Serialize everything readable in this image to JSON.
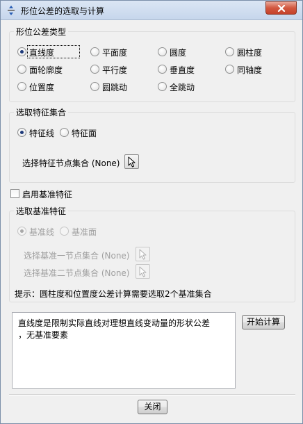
{
  "window": {
    "title": "形位公差的选取与计算"
  },
  "tolerance_type": {
    "group_label": "形位公差类型",
    "options": [
      {
        "label": "直线度",
        "checked": true
      },
      {
        "label": "平面度",
        "checked": false
      },
      {
        "label": "圆度",
        "checked": false
      },
      {
        "label": "圆柱度",
        "checked": false
      },
      {
        "label": "面轮廓度",
        "checked": false
      },
      {
        "label": "平行度",
        "checked": false
      },
      {
        "label": "垂直度",
        "checked": false
      },
      {
        "label": "同轴度",
        "checked": false
      },
      {
        "label": "位置度",
        "checked": false
      },
      {
        "label": "圆跳动",
        "checked": false
      },
      {
        "label": "全跳动",
        "checked": false
      }
    ]
  },
  "feature_set": {
    "group_label": "选取特征集合",
    "option_line": "特征线",
    "option_face": "特征面",
    "selected": "特征线",
    "node_set_label": "选择特征节点集合 (None)"
  },
  "datum_enable": {
    "label": "启用基准特征",
    "checked": false
  },
  "datum": {
    "group_label": "选取基准特征",
    "option_line": "基准线",
    "option_face": "基准面",
    "selected": "基准线",
    "node_set_1_label": "选择基准一节点集合 (None)",
    "node_set_2_label": "选择基准二节点集合 (None)"
  },
  "hint": "提示：圆柱度和位置度公差计算需要选取2个基准集合",
  "description": {
    "line1": "直线度是限制实际直线对理想直线变动量的形状公差",
    "line2": "，无基准要素"
  },
  "buttons": {
    "compute": "开始计算",
    "close": "关闭"
  },
  "colors": {
    "title_bar": "#c6d6ec",
    "close_button": "#c4412a",
    "disabled_text": "#a0a0a0"
  }
}
